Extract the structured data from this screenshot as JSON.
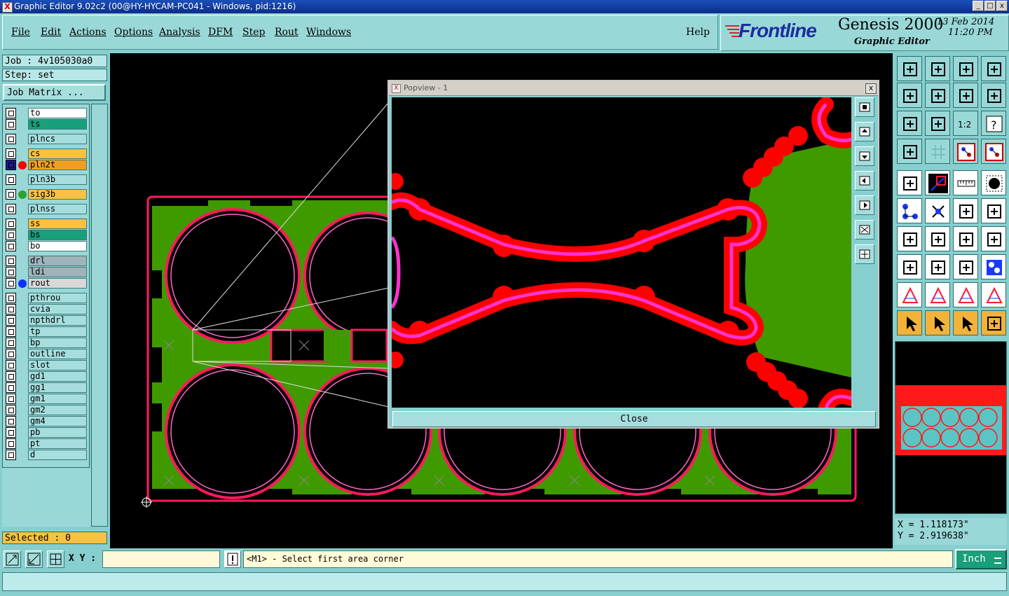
{
  "window": {
    "title": "Graphic Editor 9.02c2 (00@HY-HYCAM-PC041 - Windows, pid:1216)"
  },
  "menu": {
    "items": [
      "File",
      "Edit",
      "Actions",
      "Options",
      "Analysis",
      "DFM",
      "Step",
      "Rout",
      "Windows"
    ],
    "help": "Help"
  },
  "brand": {
    "logo": "Frontline",
    "product": "Genesis 2000",
    "subtitle": "Graphic Editor",
    "date": "13 Feb 2014",
    "time": "11:20 PM"
  },
  "job": {
    "label": "Job : 4v105030a0",
    "step": "Step: set",
    "matrix_button": "Job Matrix ..."
  },
  "layers": [
    {
      "name": "to",
      "color": "#ffffff",
      "dot": ""
    },
    {
      "name": "ts",
      "color": "#17a07a",
      "dot": ""
    },
    {
      "name": "plncs",
      "color": "#a6dede",
      "dot": ""
    },
    {
      "name": "cs",
      "color": "#f7c242",
      "dot": ""
    },
    {
      "name": "pln2t",
      "color": "#f0a020",
      "dot": "#ff0000",
      "active": true
    },
    {
      "name": "pln3b",
      "color": "#a6dede",
      "dot": ""
    },
    {
      "name": "sig3b",
      "color": "#f7c242",
      "dot": "#2fa02f"
    },
    {
      "name": "plnss",
      "color": "#a6dede",
      "dot": ""
    },
    {
      "name": "ss",
      "color": "#f7c242",
      "dot": ""
    },
    {
      "name": "bs",
      "color": "#17a07a",
      "dot": ""
    },
    {
      "name": "bo",
      "color": "#ffffff",
      "dot": ""
    },
    {
      "name": "drl",
      "color": "#9fb4b8",
      "dot": ""
    },
    {
      "name": "ldi",
      "color": "#9fb4b8",
      "dot": ""
    },
    {
      "name": "rout",
      "color": "#d8d8d8",
      "dot": "#1030ff"
    },
    {
      "name": "pthrou",
      "color": "#a6dede",
      "dot": ""
    },
    {
      "name": "cvia",
      "color": "#a6dede",
      "dot": ""
    },
    {
      "name": "npthdrl",
      "color": "#a6dede",
      "dot": ""
    },
    {
      "name": "tp",
      "color": "#a6dede",
      "dot": ""
    },
    {
      "name": "bp",
      "color": "#a6dede",
      "dot": ""
    },
    {
      "name": "outline",
      "color": "#a6dede",
      "dot": ""
    },
    {
      "name": "slot",
      "color": "#a6dede",
      "dot": ""
    },
    {
      "name": "gd1",
      "color": "#a6dede",
      "dot": ""
    },
    {
      "name": "gg1",
      "color": "#a6dede",
      "dot": ""
    },
    {
      "name": "gm1",
      "color": "#a6dede",
      "dot": ""
    },
    {
      "name": "gm2",
      "color": "#a6dede",
      "dot": ""
    },
    {
      "name": "gm4",
      "color": "#a6dede",
      "dot": ""
    },
    {
      "name": "pb",
      "color": "#a6dede",
      "dot": ""
    },
    {
      "name": "pt",
      "color": "#a6dede",
      "dot": ""
    },
    {
      "name": "d",
      "color": "#a6dede",
      "dot": ""
    }
  ],
  "selected": "Selected : 0",
  "popview": {
    "title": "Popview - 1",
    "close_label": "Close"
  },
  "coords": {
    "x": "X = 1.118173\"",
    "y": "Y = 2.919638\""
  },
  "bottom": {
    "xy_label": "X Y :",
    "xy_value": "",
    "prompt": "<M1> - Select first area corner",
    "units": "Inch"
  },
  "colors": {
    "copper": "#3f9a00",
    "rout": "#ff1a5e",
    "magenta": "#ff33cc",
    "red": "#ff0000",
    "panel": "#87cfcf"
  }
}
